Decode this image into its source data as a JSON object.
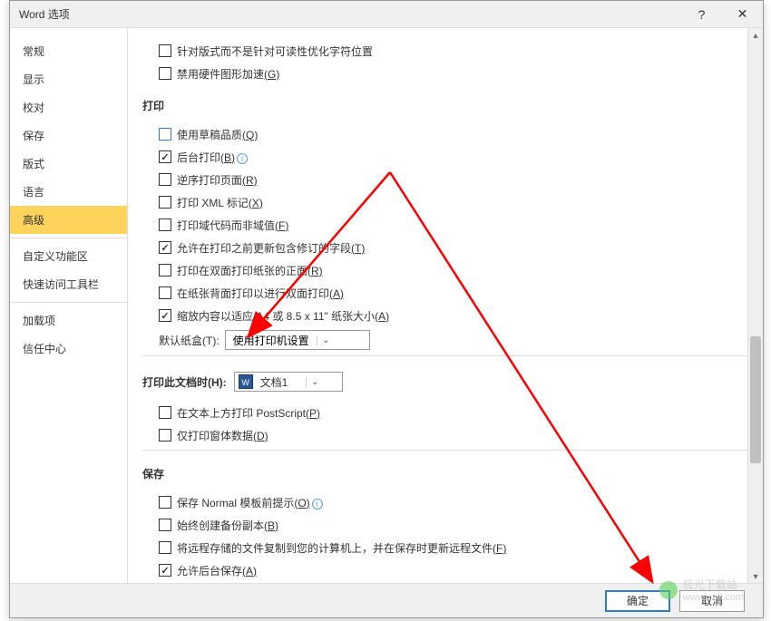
{
  "titlebar": {
    "title": "Word 选项",
    "help": "?",
    "close": "✕"
  },
  "sidebar": {
    "items": [
      {
        "label": "常规"
      },
      {
        "label": "显示"
      },
      {
        "label": "校对"
      },
      {
        "label": "保存"
      },
      {
        "label": "版式"
      },
      {
        "label": "语言"
      },
      {
        "label": "高级",
        "selected": true
      },
      {
        "label": "自定义功能区"
      },
      {
        "label": "快速访问工具栏"
      },
      {
        "label": "加载项"
      },
      {
        "label": "信任中心"
      }
    ]
  },
  "content": {
    "top_checks": [
      {
        "label": "针对版式而不是针对可读性优化字符位置",
        "checked": false,
        "shortcut": ""
      },
      {
        "label": "禁用硬件图形加速",
        "checked": false,
        "shortcut": "(G)"
      }
    ],
    "section_print": "打印",
    "print_checks": [
      {
        "label": "使用草稿品质",
        "checked": false,
        "shortcut": "(Q)",
        "blue": true
      },
      {
        "label": "后台打印",
        "checked": true,
        "shortcut": "(B)",
        "info": true
      },
      {
        "label": "逆序打印页面",
        "checked": false,
        "shortcut": "(R)"
      },
      {
        "label": "打印 XML 标记",
        "checked": false,
        "shortcut": "(X)"
      },
      {
        "label": "打印域代码而非域值",
        "checked": false,
        "shortcut": "(F)"
      },
      {
        "label": "允许在打印之前更新包含修订的字段",
        "checked": true,
        "shortcut": "(T)"
      },
      {
        "label": "打印在双面打印纸张的正面",
        "checked": false,
        "shortcut": "(R)"
      },
      {
        "label": "在纸张背面打印以进行双面打印",
        "checked": false,
        "shortcut": "(A)"
      },
      {
        "label": "缩放内容以适应 A4 或 8.5 x 11\" 纸张大小",
        "checked": true,
        "shortcut": "(A)"
      }
    ],
    "default_tray_label": "默认纸盒(T):",
    "default_tray_value": "使用打印机设置",
    "section_print_doc": "打印此文档时(H):",
    "print_doc_value": "文档1",
    "print_doc_checks": [
      {
        "label": "在文本上方打印 PostScript",
        "checked": false,
        "shortcut": "(P)"
      },
      {
        "label": "仅打印窗体数据",
        "checked": false,
        "shortcut": "(D)"
      }
    ],
    "section_save": "保存",
    "save_checks": [
      {
        "label": "保存 Normal 模板前提示",
        "checked": false,
        "shortcut": "(O)",
        "info": true
      },
      {
        "label": "始终创建备份副本",
        "checked": false,
        "shortcut": "(B)"
      },
      {
        "label": "将远程存储的文件复制到您的计算机上，并在保存时更新远程文件",
        "checked": false,
        "shortcut": "(F)"
      },
      {
        "label": "允许后台保存",
        "checked": true,
        "shortcut": "(A)"
      }
    ]
  },
  "footer": {
    "ok": "确定",
    "cancel": "取消"
  },
  "watermark": {
    "text1": "极光下载站",
    "text2": "www.xz7.com"
  }
}
